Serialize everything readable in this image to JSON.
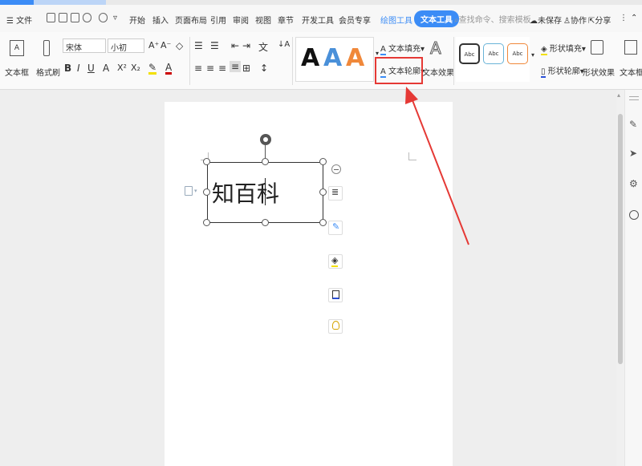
{
  "menubar": {
    "file_menu": "☰ 文件",
    "tabs": [
      "开始",
      "插入",
      "页面布局",
      "引用",
      "审阅",
      "视图",
      "章节",
      "开发工具",
      "会员专享"
    ],
    "context_tab_drawing": "绘图工具",
    "context_tab_text": "文本工具",
    "search_placeholder": "查找命令、搜索模板",
    "unsaved": "未保存",
    "collaborate": "协作",
    "share": "分享"
  },
  "ribbon": {
    "textbox_label": "文本框",
    "format_painter_label": "格式刷",
    "font_name": "宋体",
    "font_size": "小初",
    "text_fill": "文本填充",
    "text_outline": "文本轮廓",
    "text_effect": "文本效果",
    "shape_fill": "形状填充",
    "shape_outline": "形状轮廓",
    "shape_effect": "形状效果",
    "textbox_right_label": "文本框",
    "style_samples": [
      "Abc",
      "Abc",
      "Abc"
    ],
    "wordart_letter": "A",
    "format_buttons": {
      "bold": "B",
      "italic": "I",
      "underline": "U",
      "font_color_a": "A",
      "superscript": "X²",
      "subscript": "X₂",
      "grow_font": "A⁺",
      "shrink_font": "A⁻",
      "sort": "↓A"
    }
  },
  "document": {
    "textbox_text": "知百科"
  },
  "colors": {
    "accent": "#3b8cf6",
    "highlight_red": "#e53935",
    "wordart_black": "#111111",
    "wordart_blue": "#4a90d9",
    "wordart_orange": "#f0883a"
  },
  "icons": {
    "float_toolbar": [
      "minus-icon",
      "layout-icon",
      "pen-icon",
      "fill-icon",
      "outline-icon",
      "bulb-icon"
    ],
    "right_panel": [
      "pen-icon",
      "cursor-icon",
      "settings-icon",
      "help-icon"
    ]
  }
}
